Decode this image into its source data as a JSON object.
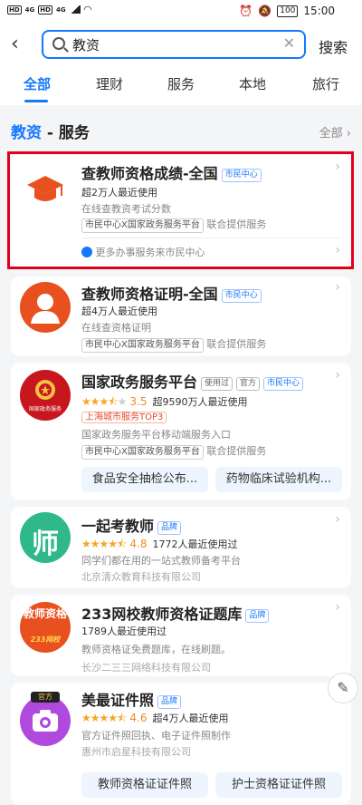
{
  "status_bar": {
    "sim1": "HD",
    "sim2": "HD",
    "net1": "4G",
    "net2": "4G",
    "battery": "100",
    "time": "15:00"
  },
  "search": {
    "query": "教资",
    "button_label": "搜索"
  },
  "tabs": [
    "全部",
    "理财",
    "服务",
    "本地",
    "旅行"
  ],
  "section": {
    "keyword": "教资",
    "title_suffix": " - 服务",
    "more": "全部 ›"
  },
  "results": [
    {
      "title": "查教师资格成绩-全国",
      "tags": [
        "市民中心"
      ],
      "usage": "超2万人最近使用",
      "desc": "在线查教资考试分数",
      "provider": "市民中心X国家政务服务平台",
      "provider_suffix": "联合提供服务",
      "footer": "更多办事服务来市民中心"
    },
    {
      "title": "查教师资格证明-全国",
      "tags": [
        "市民中心"
      ],
      "usage": "超4万人最近使用",
      "desc": "在线查资格证明",
      "provider": "市民中心X国家政务服务平台",
      "provider_suffix": "联合提供服务"
    },
    {
      "title": "国家政务服务平台",
      "tags": [
        "使用过",
        "官方",
        "市民中心"
      ],
      "rating": "3.5",
      "usage": "超9590万人最近使用",
      "rank": "上海城市服务TOP3",
      "desc": "国家政务服务平台移动端服务入口",
      "provider": "市民中心X国家政务服务平台",
      "provider_suffix": "联合提供服务",
      "icon_text": "国家政务服务",
      "sub_buttons": [
        "食品安全抽检公布...",
        "药物临床试验机构..."
      ]
    },
    {
      "title": "一起考教师",
      "tags": [
        "品牌"
      ],
      "rating": "4.8",
      "usage": "1772人最近使用过",
      "desc": "同学们都在用的一站式教师备考平台",
      "company": "北京清众教育科技有限公司",
      "icon_text": "师"
    },
    {
      "title": "233网校教师资格证题库",
      "tags": [
        "品牌"
      ],
      "usage": "1789人最近使用过",
      "desc": "教师资格证免费题库，在线刷题。",
      "company": "长沙二三三网络科技有限公司",
      "icon_text": "教师资格",
      "icon_sub": "233网校"
    },
    {
      "title": "美最证件照",
      "tags": [
        "品牌"
      ],
      "rating": "4.6",
      "usage": "超4万人最近使用",
      "desc": "官方证件照回执、电子证件照制作",
      "company": "惠州市启星科技有限公司",
      "icon_badge": "官方",
      "sub_buttons": [
        "教师资格证证件照",
        "护士资格证证件照"
      ]
    }
  ],
  "colors": {
    "accent": "#1677ff",
    "highlight": "#e0001b",
    "star": "#f5a623"
  }
}
